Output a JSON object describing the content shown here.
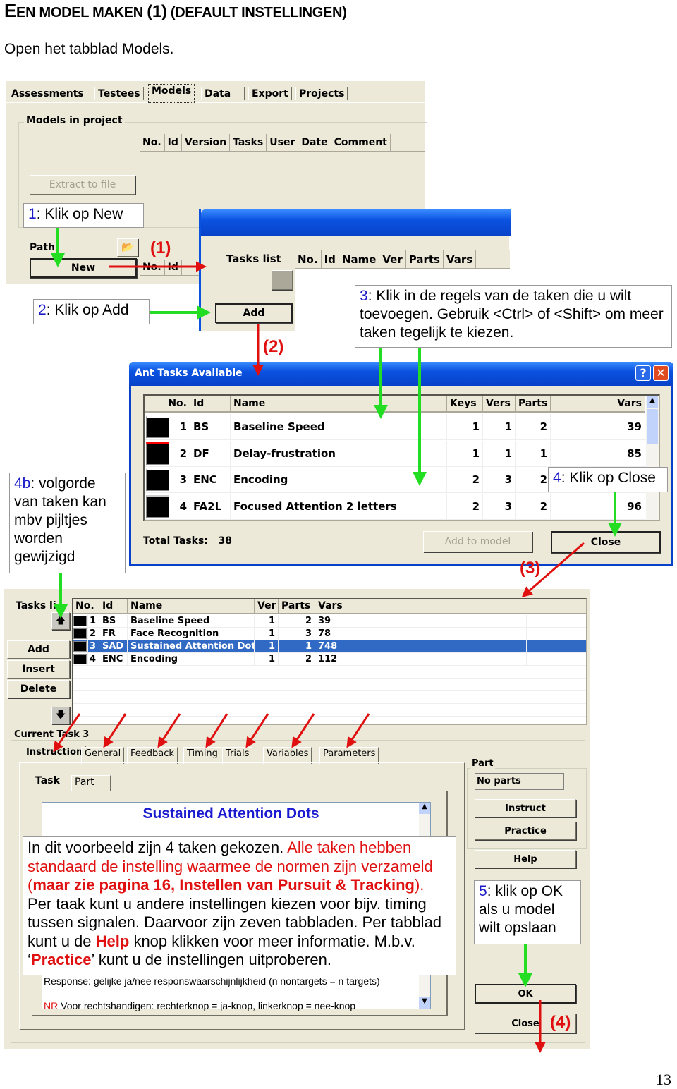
{
  "heading": {
    "prefix": "E",
    "rest": "EN MODEL MAKEN ",
    "paren": "(1)",
    "rest2": " (DEFAULT INSTELLINGEN)"
  },
  "intro": "Open het tabblad Models.",
  "shot1": {
    "tabs": [
      "Assessments",
      "Testees",
      "Models",
      "Data",
      "Export",
      "Projects"
    ],
    "active_tab": "Models",
    "group_title": "Models in project",
    "columns": [
      "No.",
      "Id",
      "Version",
      "Tasks",
      "User",
      "Date",
      "Comment"
    ],
    "extract_button": "Extract to file",
    "path_label": "Path",
    "new_button": "New",
    "mini_columns": [
      "No.",
      "Id"
    ]
  },
  "tasks_window": {
    "label": "Tasks list",
    "columns": [
      "No.",
      "Id",
      "Name",
      "Ver",
      "Parts",
      "Vars"
    ],
    "add_button": "Add"
  },
  "callouts": {
    "c1": {
      "num": "1",
      "text": ": Klik op New"
    },
    "c2": {
      "num": "2",
      "text": ": Klik op Add"
    },
    "c3": {
      "num": "3",
      "text": ": Klik in de regels van de taken die u wilt toevoegen. Gebruik <Ctrl> of <Shift> om meer taken tegelijk te kiezen."
    },
    "c4": {
      "num": "4",
      "text": ": Klik op Close"
    },
    "c4b": {
      "num": "4b",
      "text": ": volgorde van taken kan mbv pijltjes worden gewijzigd"
    },
    "c5": {
      "num": "5",
      "text": ": klik op OK als u model wilt opslaan"
    },
    "main": {
      "t1": "In dit voorbeeld zijn 4 taken gekozen. ",
      "t2": "Alle taken hebben standaard de instelling waarmee de normen zijn verzameld (",
      "t3": "maar zie pagina 16, Instellen van Pursuit & Tracking",
      "t4": ").",
      "t5": " Per taak kunt u andere instellingen kiezen voor bijv. timing tussen signalen. Daarvoor zijn zeven tabbladen. Per tabblad kunt u de ",
      "t6": "Help",
      "t7": " knop klikken voor meer informatie. M.b.v. ‘",
      "t8": "Practice",
      "t9": "’ kunt u de instellingen uitproberen."
    }
  },
  "markers": {
    "m1": "(1)",
    "m2": "(2)",
    "m3": "(3)",
    "m4": "(4)"
  },
  "dialog": {
    "title": "Ant Tasks Available",
    "help_icon": "question-icon",
    "close_icon": "x-icon",
    "columns": [
      "No.",
      "Id",
      "Name",
      "Keys",
      "Vers",
      "Parts",
      "Vars"
    ],
    "rows": [
      {
        "no": "1",
        "id": "BS",
        "name": "Baseline Speed",
        "keys": "1",
        "vers": "1",
        "parts": "2",
        "vars": "39"
      },
      {
        "no": "2",
        "id": "DF",
        "name": "Delay-frustration",
        "keys": "1",
        "vers": "1",
        "parts": "1",
        "vars": "85"
      },
      {
        "no": "3",
        "id": "ENC",
        "name": "Encoding",
        "keys": "2",
        "vers": "3",
        "parts": "2",
        "vars": ""
      },
      {
        "no": "4",
        "id": "FA2L",
        "name": "Focused Attention 2 letters",
        "keys": "2",
        "vers": "3",
        "parts": "2",
        "vars": "96"
      }
    ],
    "total_label": "Total Tasks:",
    "total_value": "38",
    "add_to_model": "Add to model",
    "close": "Close"
  },
  "shot2": {
    "tasks_label": "Tasks li",
    "buttons": {
      "add": "Add",
      "insert": "Insert",
      "delete": "Delete"
    },
    "columns": [
      "No.",
      "Id",
      "Name",
      "Ver",
      "Parts",
      "Vars"
    ],
    "rows": [
      {
        "no": "1",
        "id": "BS",
        "name": "Baseline Speed",
        "ver": "1",
        "parts": "2",
        "vars": "39"
      },
      {
        "no": "2",
        "id": "FR",
        "name": "Face Recognition",
        "ver": "1",
        "parts": "3",
        "vars": "78"
      },
      {
        "no": "3",
        "id": "SAD",
        "name": "Sustained Attention Dots",
        "ver": "1",
        "parts": "1",
        "vars": "748",
        "selected": true
      },
      {
        "no": "4",
        "id": "ENC",
        "name": "Encoding",
        "ver": "1",
        "parts": "2",
        "vars": "112"
      }
    ],
    "current_task": "Current Task 3",
    "tabs": [
      "Instruction",
      "General",
      "Feedback",
      "Timing",
      "Trials",
      "Variables",
      "Parameters"
    ],
    "subtabs": [
      "Task",
      "Part"
    ],
    "part_group": "Part",
    "part_value": "No parts",
    "instr_title": "Sustained Attention Dots",
    "response_line": "Response: gelijke ja/nee responswaarschijnlijkheid (n nontargets = n targets)",
    "nr_prefix": "NR",
    "nr_line": " Voor rechtshandigen: rechterknop = ja-knop, linkerknop = nee-knop",
    "side_buttons": {
      "instruct": "Instruct",
      "practice": "Practice",
      "help": "Help",
      "ok": "OK",
      "close": "Close"
    }
  },
  "page_number": "13",
  "colors": {
    "callout_number": "#1a1ac8",
    "annotation_red": "#e01010",
    "arrow_green": "#22dd22",
    "xp_blue": "#0a52e0",
    "selection": "#316ac5"
  }
}
